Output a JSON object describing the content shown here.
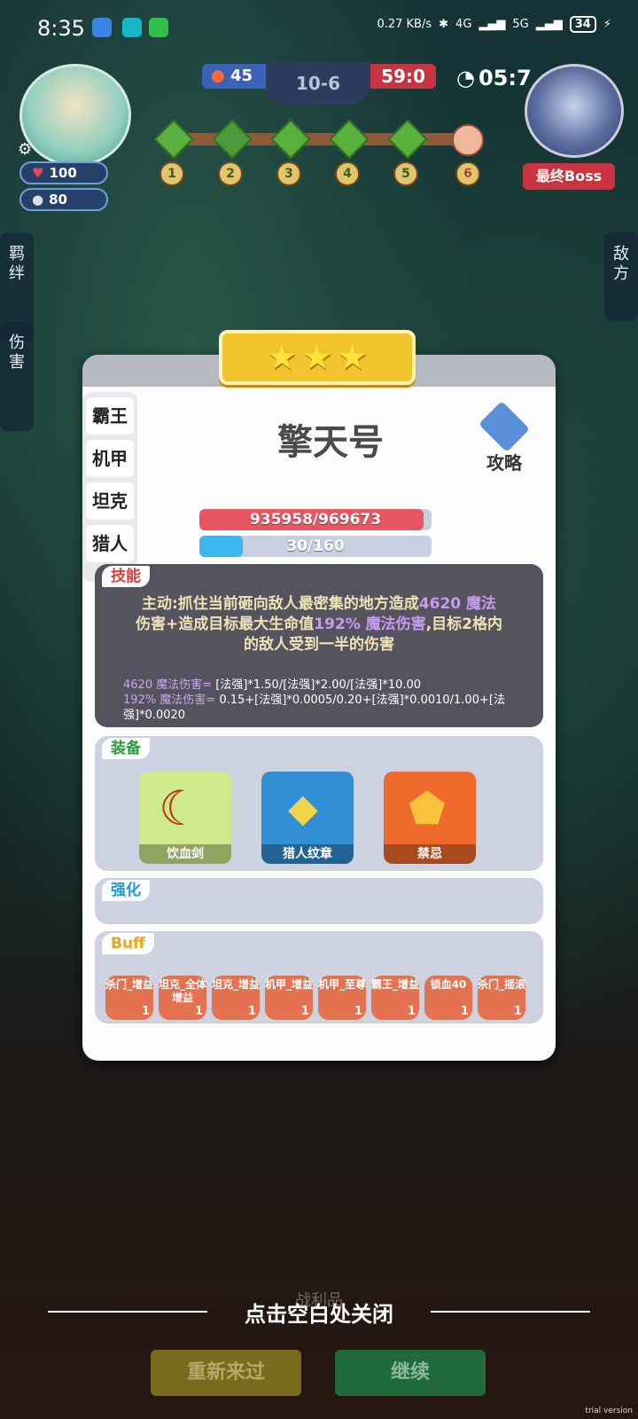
{
  "status": {
    "time": "8:35",
    "net": "0.27 KB/s",
    "signal1": "4G",
    "signal2": "5G",
    "battery": "34"
  },
  "player": {
    "hp": "100",
    "gold": "80"
  },
  "hud": {
    "left_value": "45",
    "stage": "10-6",
    "right_value": "59:0",
    "timer": "05:7",
    "boss_label": "最终Boss",
    "nodes": [
      "1",
      "2",
      "3",
      "4",
      "5",
      "6"
    ]
  },
  "side": {
    "left_tabs": [
      "羁绊",
      "伤害"
    ],
    "right_tab": "敌方"
  },
  "panel": {
    "stars": 3,
    "tabs": [
      "霸王",
      "机甲",
      "坦克",
      "猎人"
    ],
    "hero_name": "擎天号",
    "guide_label": "攻略",
    "hp_text": "935958/969673",
    "hp_fraction": 0.965,
    "mana_text": "30/160",
    "mana_fraction": 0.1875,
    "skill": {
      "label": "技能",
      "line1a": "主动:抓住当前砸向敌人最密集的地方造成",
      "line1b": "4620 魔法",
      "line2a": "伤害+造成目标最大生命值",
      "line2b": "192% 魔法伤害",
      "line2c": ",目标2格内",
      "line3": "的敌人受到一半的伤害",
      "f1_label": "4620 魔法伤害=",
      "f1_value": " [法强]*1.50/[法强]*2.00/[法强]*10.00",
      "f2_label": "192% 魔法伤害=",
      "f2_value": " 0.15+[法强]*0.0005/0.20+[法强]*0.0010/1.00+[法强]*0.0020"
    },
    "equipment": {
      "label": "装备",
      "items": [
        "饮血剑",
        "猎人纹章",
        "禁忌"
      ]
    },
    "enhance": {
      "label": "强化"
    },
    "buff": {
      "label": "Buff",
      "items": [
        {
          "name": "杀门_增益",
          "count": "1"
        },
        {
          "name": "坦克_全体增益",
          "count": "1"
        },
        {
          "name": "坦克_增益",
          "count": "1"
        },
        {
          "name": "机甲_增益",
          "count": "1"
        },
        {
          "name": "机甲_至尊",
          "count": "1"
        },
        {
          "name": "霸王_增益",
          "count": "1"
        },
        {
          "name": "锁血40",
          "count": "1"
        },
        {
          "name": "杀门_摇滚",
          "count": "1"
        }
      ]
    }
  },
  "bottom": {
    "close_hint": "点击空白处关闭",
    "restart": "重新来过",
    "continue": "继续",
    "loot": "战利品"
  },
  "watermark": "trial version"
}
